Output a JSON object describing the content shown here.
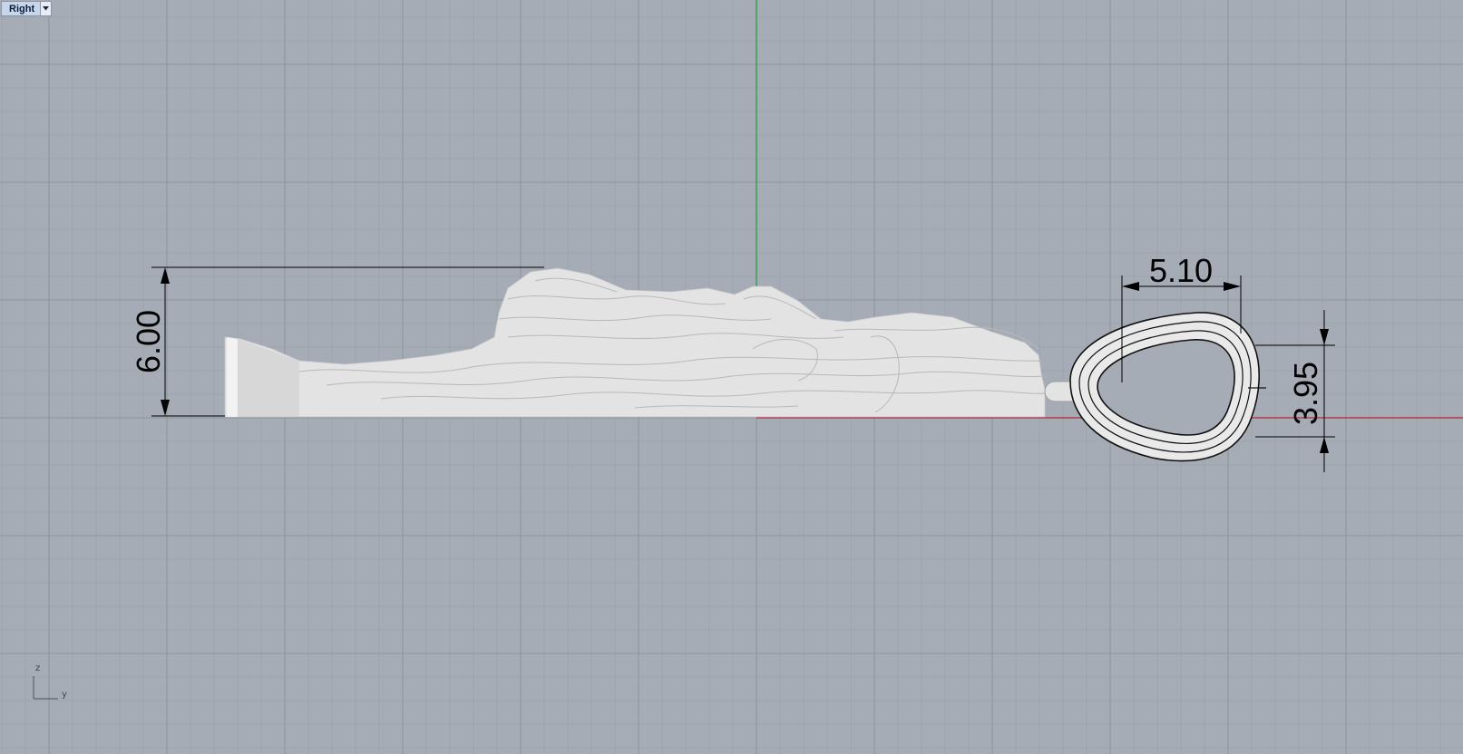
{
  "viewport": {
    "name": "Right"
  },
  "dimensions": {
    "height_main": "6.00",
    "width_loop": "5.10",
    "height_loop": "3.95"
  },
  "axis_icon": {
    "vertical_label": "z",
    "horizontal_label": "y"
  },
  "colors": {
    "background": "#a5acb5",
    "grid_minor": "#9aa1aa",
    "grid_major": "#8e959e",
    "axis_green": "#1f9e3a",
    "axis_red": "#b3282d",
    "model": "#e3e3e3"
  }
}
